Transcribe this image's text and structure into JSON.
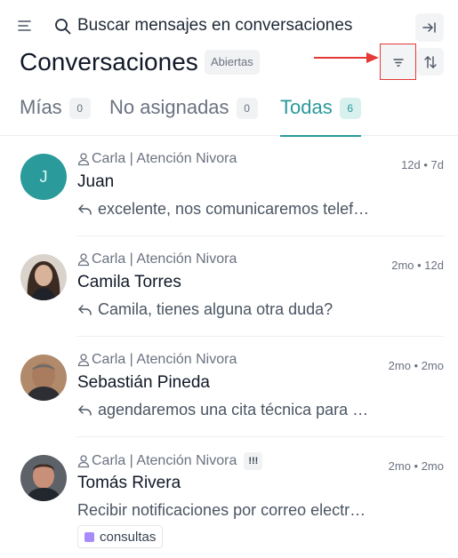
{
  "search": {
    "placeholder": "Buscar mensajes en conversaciones"
  },
  "header": {
    "title": "Conversaciones",
    "status": "Abiertas"
  },
  "tabs": [
    {
      "label": "Mías",
      "count": "0",
      "active": false
    },
    {
      "label": "No asignadas",
      "count": "0",
      "active": false
    },
    {
      "label": "Todas",
      "count": "6",
      "active": true
    }
  ],
  "conversations": [
    {
      "agent": "Carla | Atención Nivora",
      "name": "Juan",
      "initial": "J",
      "time": "12d • 7d",
      "preview": "excelente, nos comunicaremos telef…",
      "replied": true
    },
    {
      "agent": "Carla | Atención Nivora",
      "name": "Camila Torres",
      "time": "2mo • 12d",
      "preview": "Camila, tienes alguna otra duda?",
      "replied": true
    },
    {
      "agent": "Carla | Atención Nivora",
      "name": "Sebastián Pineda",
      "time": "2mo • 2mo",
      "preview": "agendaremos una cita técnica para …",
      "replied": true
    },
    {
      "agent": "Carla | Atención Nivora",
      "priority": "!!!",
      "name": "Tomás Rivera",
      "time": "2mo • 2mo",
      "preview": "Recibir notificaciones por correo electr…",
      "replied": false,
      "label": "consultas"
    }
  ],
  "icons": {
    "menu": "menu-icon",
    "search": "search-icon",
    "collapse": "arrow-to-right-icon",
    "filter": "filter-icon",
    "sort": "sort-arrows-icon",
    "agent": "user-icon",
    "reply": "reply-icon"
  },
  "colors": {
    "accent": "#2a9a9a",
    "annotation": "#e53935",
    "label": "#a78bfa"
  }
}
